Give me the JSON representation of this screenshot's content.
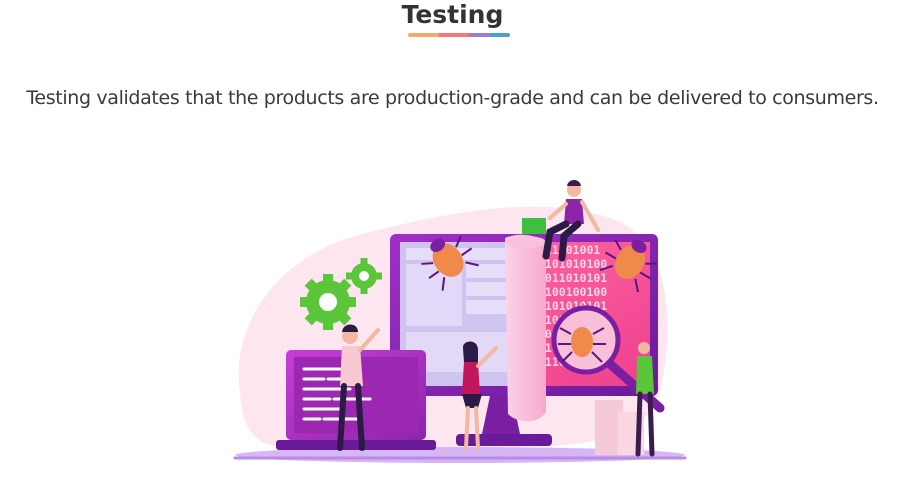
{
  "section": {
    "title": "Testing",
    "underline_colors": [
      "#f5a86b",
      "#f27a7a",
      "#9b7ed3",
      "#4a9fd8"
    ],
    "description": "Testing validates that the products are production-grade and can be delivered to consumers."
  },
  "illustration": {
    "subject": "software-testing-illustration",
    "binary_lines": [
      "011001001",
      "0101010100",
      "1011010101",
      "0100100100",
      "0101010101",
      "0101100100",
      "101101010",
      "010110101",
      "0110010"
    ],
    "colors": {
      "accent_purple": "#8e24aa",
      "accent_pink": "#e040a0",
      "bug_orange": "#f08a4b",
      "gear_green": "#5cc63a",
      "background_blob": "#fde6ef",
      "ground": "#cfa9f0"
    }
  }
}
